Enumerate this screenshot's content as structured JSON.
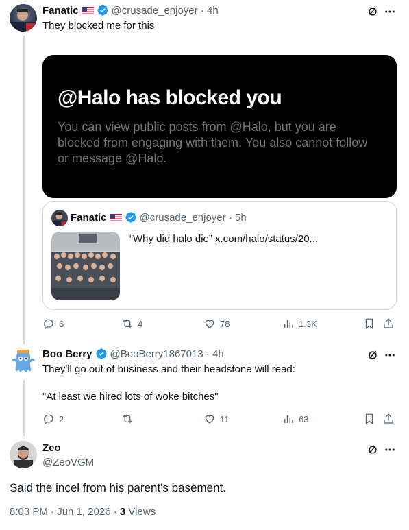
{
  "posts": [
    {
      "name": "Fanatic",
      "handle": "@crusade_enjoyer",
      "time": "4h",
      "text": "They blocked me for this",
      "media": {
        "title": "@Halo has blocked you",
        "body": "You can view public posts from @Halo, but you are blocked from engaging with them. You also cannot follow or message @Halo."
      },
      "quote": {
        "name": "Fanatic",
        "handle": "@crusade_enjoyer",
        "time": "5h",
        "text": "“Why did halo die”  x.com/halo/status/20..."
      },
      "stats": {
        "replies": "6",
        "reposts": "4",
        "likes": "78",
        "views": "1.3K"
      }
    },
    {
      "name": "Boo Berry",
      "handle": "@BooBerry1867013",
      "time": "4h",
      "text_line1": "They'll go out of business and their headstone will read:",
      "text_line2": "\"At least we hired lots of woke bitches\"",
      "stats": {
        "replies": "2",
        "reposts": "",
        "likes": "11",
        "views": "63"
      }
    }
  ],
  "main_post": {
    "name": "Zeo",
    "handle": "@ZeoVGM",
    "text": "Said the incel from his parent's basement.",
    "timestamp": "8:03 PM · Jun 1, 2026 · ",
    "views_count": "3",
    "views_label": " Views"
  },
  "colors": {
    "verified": "#1d9bf0",
    "muted": "#536471",
    "border": "#cfd9de",
    "text": "#0f1419"
  },
  "icons": [
    "grok-icon",
    "more-icon",
    "reply-icon",
    "repost-icon",
    "like-icon",
    "views-icon",
    "bookmark-icon",
    "share-icon",
    "verified-icon",
    "us-flag-icon"
  ]
}
